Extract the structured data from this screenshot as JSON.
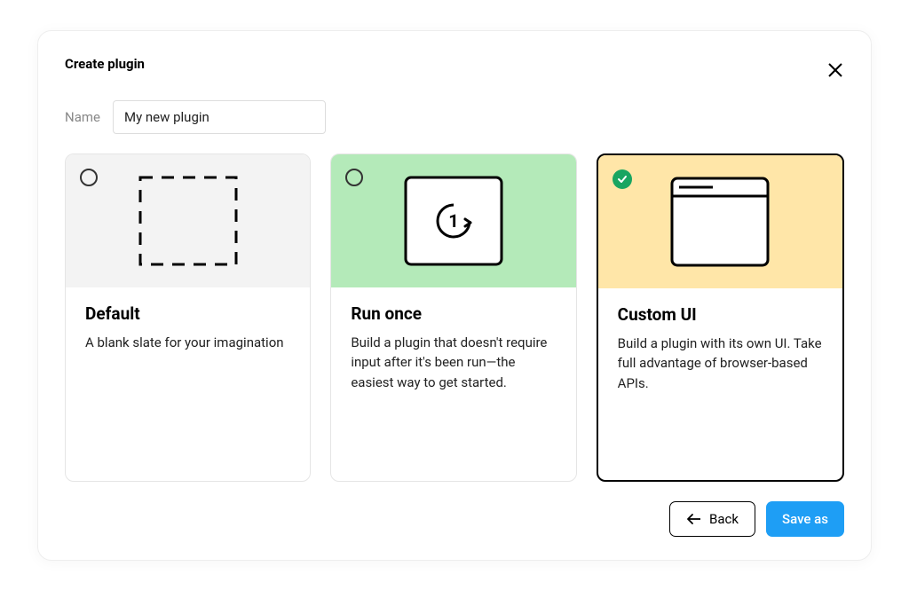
{
  "dialog": {
    "title": "Create plugin"
  },
  "name": {
    "label": "Name",
    "value": "My new plugin"
  },
  "options": [
    {
      "id": "default",
      "title": "Default",
      "description": "A blank slate for your imagination",
      "selected": false,
      "illustration_bg": "#f3f3f3"
    },
    {
      "id": "run-once",
      "title": "Run once",
      "description": "Build a plugin that doesn't require input after it's been run—the easiest way to get started.",
      "selected": false,
      "illustration_bg": "#b4eab9"
    },
    {
      "id": "custom-ui",
      "title": "Custom UI",
      "description": "Build a plugin with its own UI. Take full advantage of browser-based APIs.",
      "selected": true,
      "illustration_bg": "#ffe6a8"
    }
  ],
  "footer": {
    "back_label": "Back",
    "save_label": "Save as"
  }
}
